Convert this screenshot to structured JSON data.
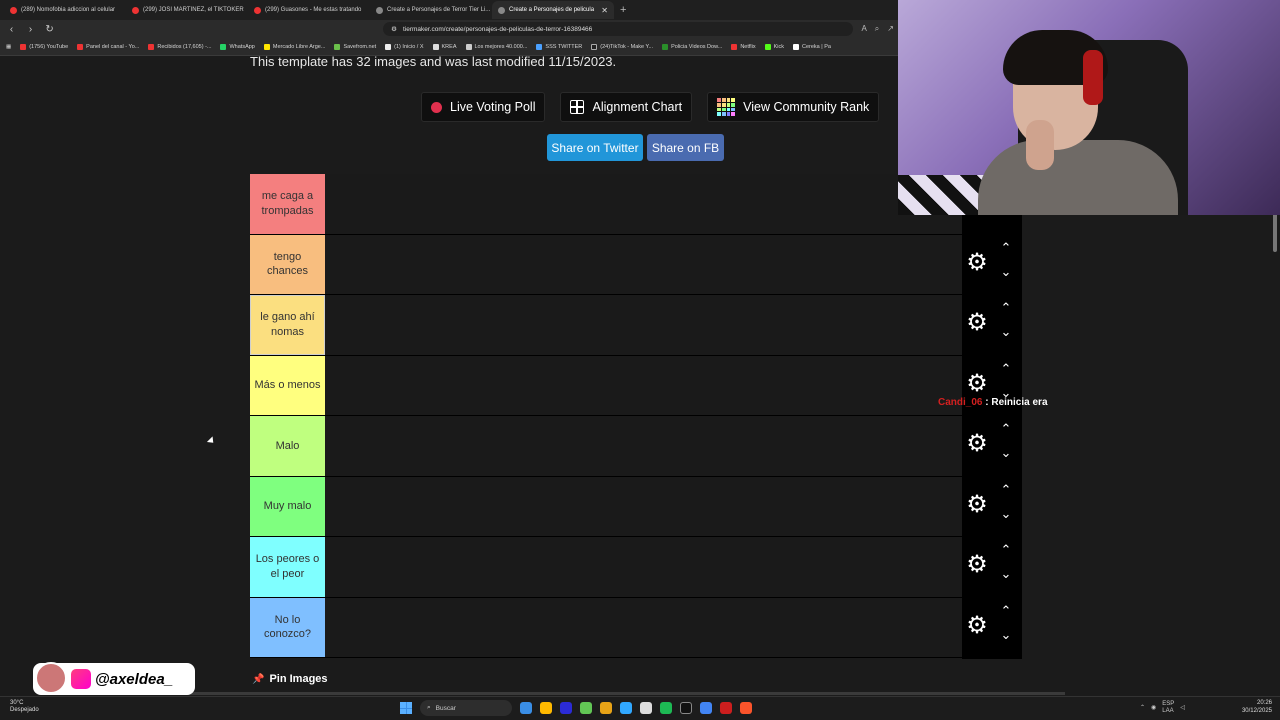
{
  "browser": {
    "tabs": [
      {
        "title": "(289) Nomofobia adiccion al celular",
        "active": false
      },
      {
        "title": "(299) JOSI MARTINEZ, el TIKTOKER",
        "active": false
      },
      {
        "title": "(299) Guasones - Me estas tratando",
        "active": false
      },
      {
        "title": "Create a Personajes de Terror Tier Li...",
        "active": false
      },
      {
        "title": "Create a Personajes de pelicula",
        "active": true
      }
    ],
    "url": "tiermaker.com/create/personajes-de-peliculas-de-terror-16389466",
    "bookmarks": [
      "(1756) YouTube",
      "Panel del canal - Yo...",
      "Recibidos (17,605) -...",
      "WhatsApp",
      "Mercado Libre Arge...",
      "Savefrom.net",
      "(1) Inicio / X",
      "KREA",
      "Los mejores 40.000...",
      "SSS TWITTER",
      "(24)TikTok - Make Y...",
      "Policia Videos Dow...",
      "Netflix",
      "Kick",
      "Cereka | Pa"
    ]
  },
  "page": {
    "template_info": "This template has 32 images and was last modified 11/15/2023.",
    "buttons": {
      "live_voting": "Live Voting Poll",
      "alignment_chart": "Alignment Chart",
      "community_rank": "View Community Rank",
      "share_twitter": "Share on Twitter",
      "share_fb": "Share on FB"
    },
    "tiers": [
      {
        "label": "me caga a trompadas",
        "color": "#f47f7f"
      },
      {
        "label": "tengo chances",
        "color": "#f8be7f"
      },
      {
        "label": "le gano ahí nomas",
        "color": "#fbdf80",
        "selected": true
      },
      {
        "label": "Más o menos",
        "color": "#ffff7f"
      },
      {
        "label": "Malo",
        "color": "#bfff7f"
      },
      {
        "label": "Muy malo",
        "color": "#7fff7f"
      },
      {
        "label": "Los peores o el peor",
        "color": "#7fffff"
      },
      {
        "label": "No lo conozco?",
        "color": "#7fbfff"
      }
    ],
    "pin_images": "Pin Images"
  },
  "overlay": {
    "chat_user": "Candi_06",
    "chat_sep": " : ",
    "chat_text": "Reinicia era",
    "streamer_handle": "@axeldea_"
  },
  "taskbar": {
    "weather_temp": "30°C",
    "weather_desc": "Despejado",
    "search": "Buscar",
    "lang": "ESP",
    "lang2": "LAA",
    "time": "20:26",
    "date": "30/12/2025"
  }
}
